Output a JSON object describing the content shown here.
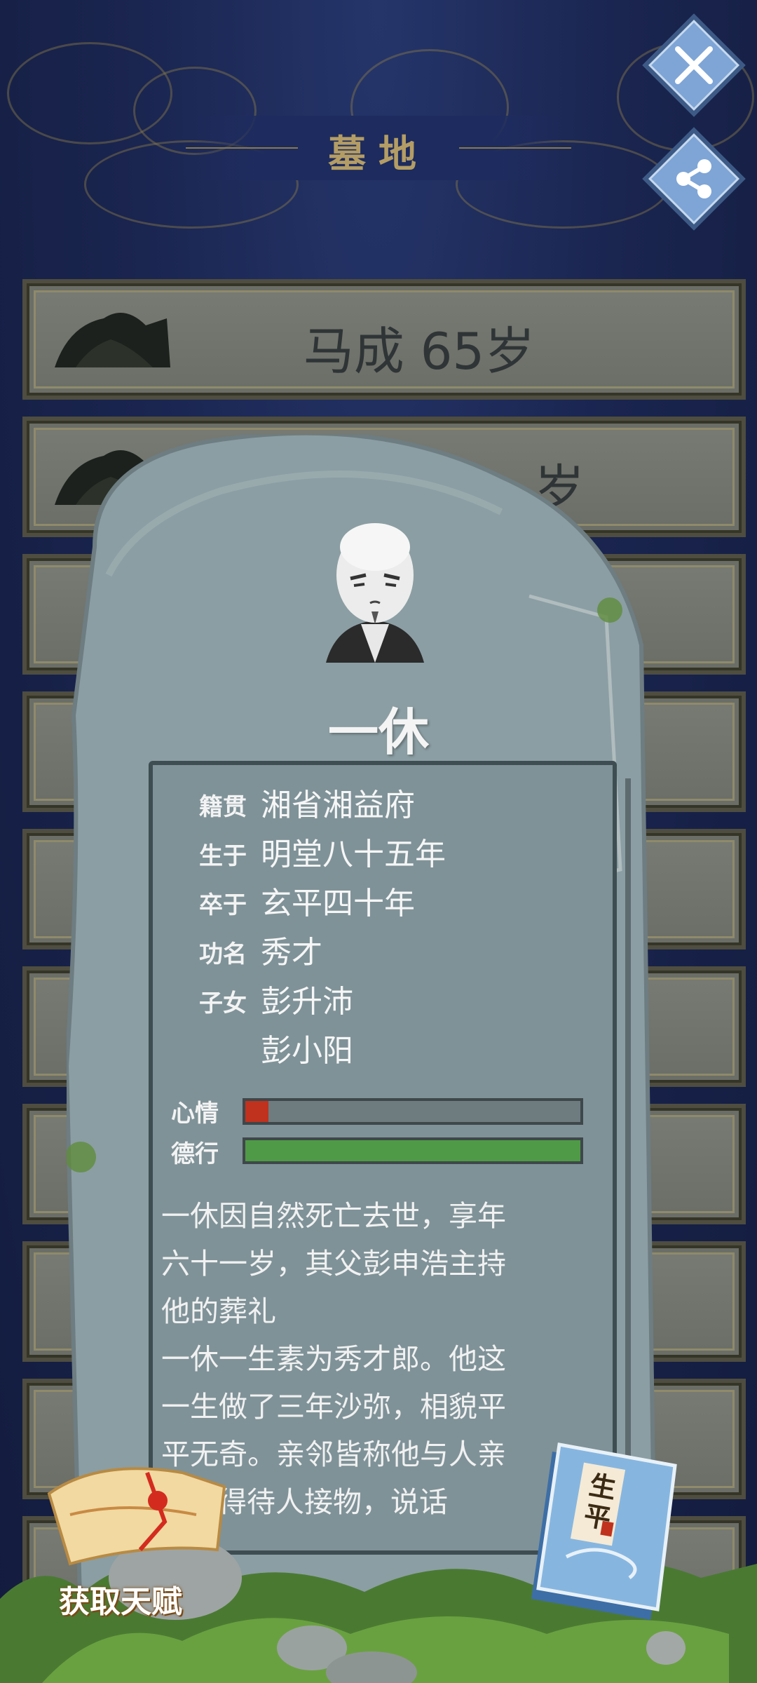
{
  "header": {
    "title": "墓地"
  },
  "buttons": {
    "close_icon": "close-x-icon",
    "share_icon": "share-icon"
  },
  "graves": [
    {
      "label": "马成 65岁"
    },
    {
      "label": "岁"
    }
  ],
  "tombstone": {
    "name": "一休",
    "info": [
      {
        "key": "籍贯",
        "value": "湘省湘益府"
      },
      {
        "key": "生于",
        "value": "明堂八十五年"
      },
      {
        "key": "卒于",
        "value": "玄平四十年"
      },
      {
        "key": "功名",
        "value": "秀才"
      },
      {
        "key": "子女",
        "value": "彭升沛"
      },
      {
        "key": "",
        "value": "彭小阳"
      }
    ],
    "mood_label": "心情",
    "mood_value": 0.07,
    "virtue_label": "德行",
    "virtue_value": 1.0,
    "story": [
      "一休因自然死亡去世，享年",
      "六十一岁，其父彭申浩主持",
      "他的葬礼",
      "一休一生素为秀才郎。他这",
      "一生做了三年沙弥，相貌平",
      "平无奇。亲邻皆称他与人亲",
      "懂得待人接物，说话"
    ]
  },
  "talent_button": {
    "label": "获取天赋"
  },
  "book": {
    "cover": "生平"
  },
  "colors": {
    "mood": "#c0321e",
    "virtue": "#4f9a46",
    "title": "#b49d65"
  }
}
